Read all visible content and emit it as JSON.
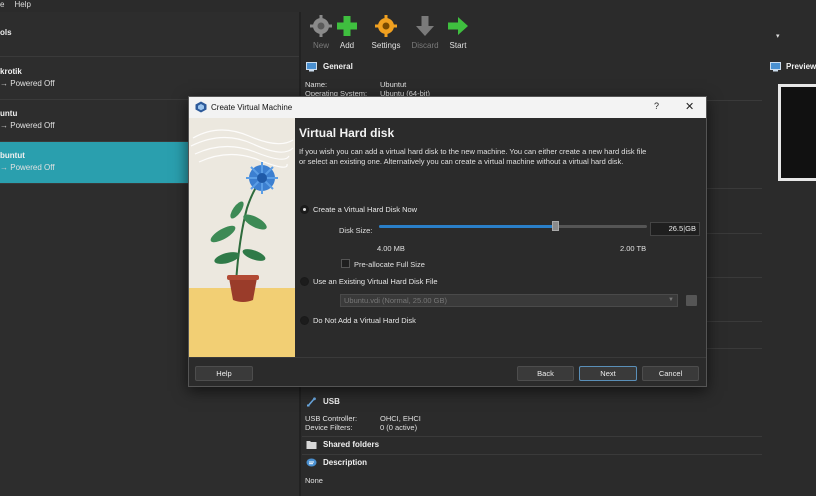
{
  "menubar": {
    "items": [
      "e",
      "Help"
    ]
  },
  "left_pane": {
    "tools_label": "ols",
    "vms": [
      {
        "name": "krotik",
        "state": "Powered Off",
        "selected": false
      },
      {
        "name": "untu",
        "state": "Powered Off",
        "selected": false
      },
      {
        "name": "buntut",
        "state": "Powered Off",
        "selected": true
      }
    ]
  },
  "toolbar": {
    "new_label": "New",
    "add_label": "Add",
    "settings_label": "Settings",
    "discard_label": "Discard",
    "start_label": "Start"
  },
  "details": {
    "general_title": "General",
    "name_key": "Name:",
    "name_val": "Ubuntut",
    "os_key": "Operating System:",
    "os_val": "Ubuntu (64-bit)",
    "usb_title": "USB",
    "usb_controller_key": "USB Controller:",
    "usb_controller_val": "OHCI, EHCI",
    "device_filters_key": "Device Filters:",
    "device_filters_val": "0 (0 active)",
    "shared_title": "Shared folders",
    "desc_title": "Description",
    "desc_val": "None"
  },
  "preview": {
    "title": "Preview"
  },
  "dialog": {
    "title": "Create Virtual Machine",
    "help_glyph": "?",
    "close_glyph": "✕",
    "heading": "Virtual Hard disk",
    "description": "If you wish you can add a virtual hard disk to the new machine. You can either create a new hard disk file or select an existing one. Alternatively you can create a virtual machine without a virtual hard disk.",
    "opt_create": "Create a Virtual Hard Disk Now",
    "disk_size_label": "Disk Size:",
    "disk_size_value": "26.5",
    "disk_size_unit": "GB",
    "slider_fraction": 0.66,
    "min_label": "4.00 MB",
    "max_label": "2.00 TB",
    "preallocate_label": "Pre-allocate Full Size",
    "opt_existing": "Use an Existing Virtual Hard Disk File",
    "existing_value": "Ubuntu.vdi (Normal, 25.00 GB)",
    "opt_none": "Do Not Add a Virtual Hard Disk",
    "help_btn": "Help",
    "back_btn": "Back",
    "next_btn": "Next",
    "cancel_btn": "Cancel"
  },
  "colors": {
    "selection": "#2a9fae",
    "accent_green": "#3fbf3f",
    "accent_orange": "#f0a020",
    "window_bg": "#2b2b2b"
  }
}
